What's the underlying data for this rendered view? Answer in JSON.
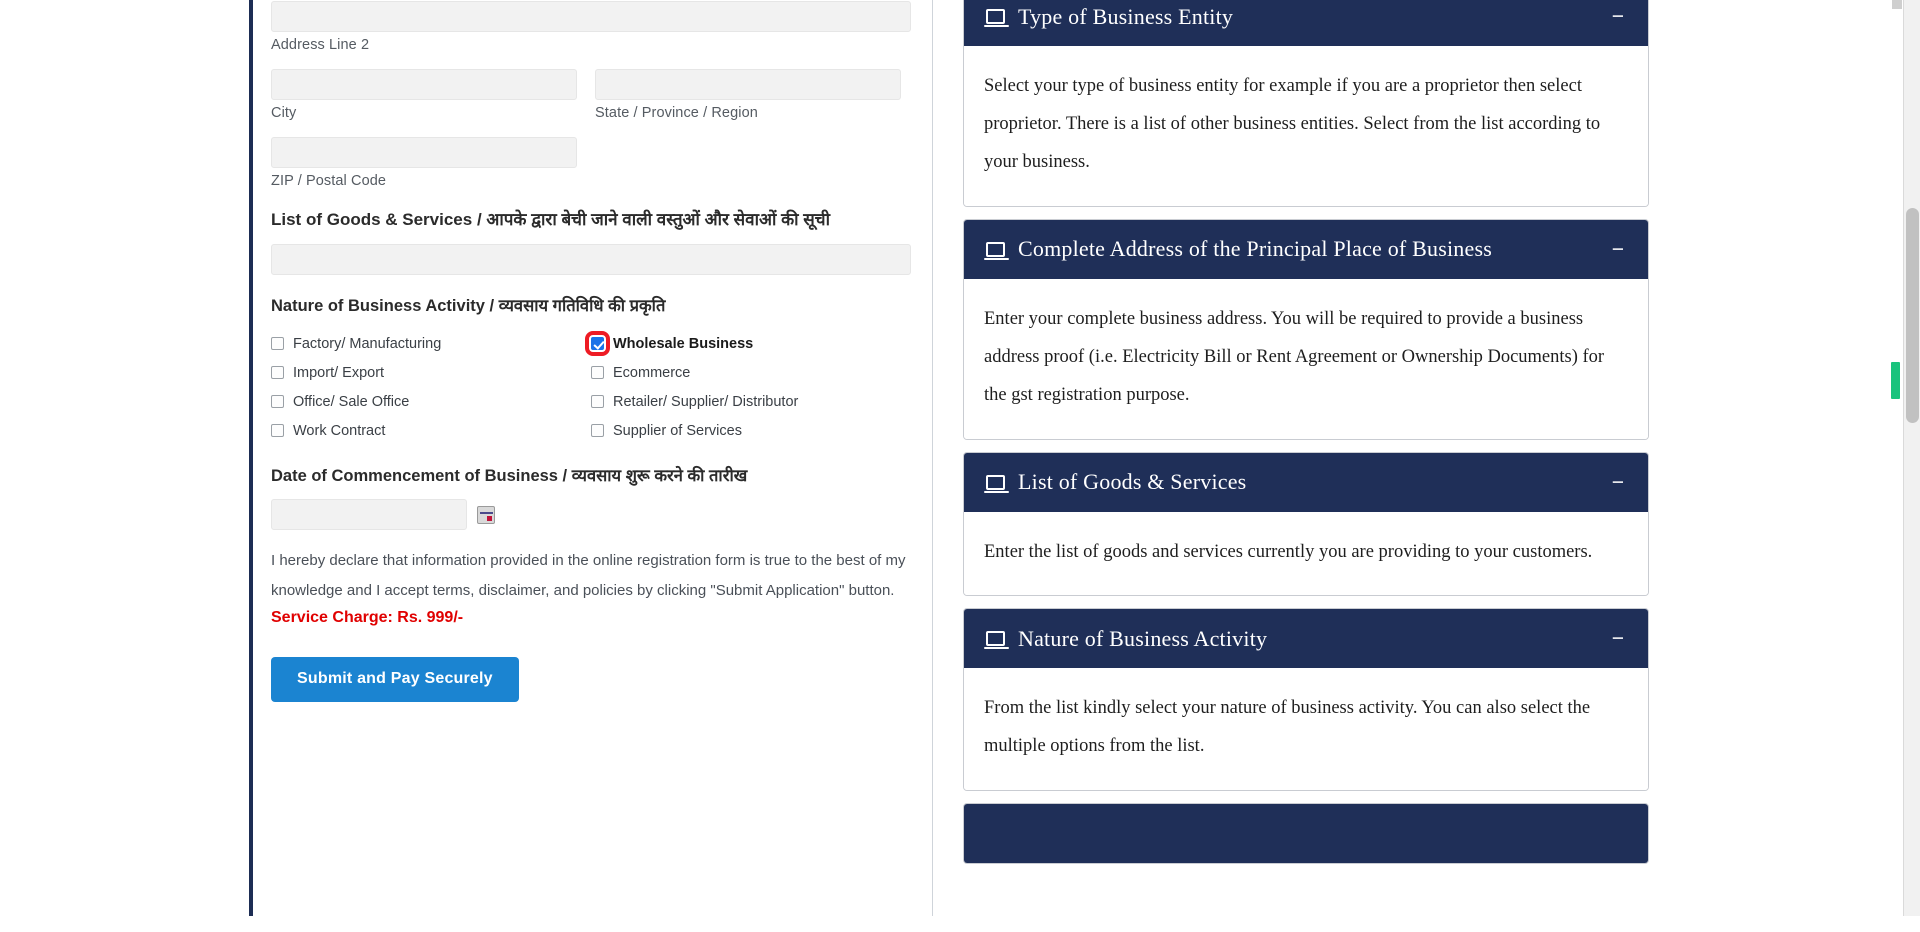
{
  "form": {
    "address_line2_caption": "Address Line 2",
    "city_caption": "City",
    "state_caption": "State / Province / Region",
    "zip_caption": "ZIP / Postal Code",
    "goods_services_title": "List of Goods & Services / आपके द्वारा बेची जाने वाली वस्तुओं और सेवाओं की सूची",
    "nature_title": "Nature of Business Activity / व्यवसाय गतिविधि की प्रकृति",
    "checkboxes": [
      {
        "label": "Factory/ Manufacturing",
        "checked": false,
        "highlighted": false
      },
      {
        "label": "Wholesale Business",
        "checked": true,
        "highlighted": true
      },
      {
        "label": "Import/ Export",
        "checked": false,
        "highlighted": false
      },
      {
        "label": "Ecommerce",
        "checked": false,
        "highlighted": false
      },
      {
        "label": "Office/ Sale Office",
        "checked": false,
        "highlighted": false
      },
      {
        "label": "Retailer/ Supplier/ Distributor",
        "checked": false,
        "highlighted": false
      },
      {
        "label": "Work Contract",
        "checked": false,
        "highlighted": false
      },
      {
        "label": "Supplier of Services",
        "checked": false,
        "highlighted": false
      }
    ],
    "date_title": "Date of Commencement of Business / व्यवसाय शुरू करने की तारीख",
    "date_value": "",
    "declaration": "I hereby declare that information provided in the online registration form is true to the best of my knowledge and I accept terms, disclaimer, and policies by clicking \"Submit Application\" button.",
    "service_charge": "Service Charge: Rs. 999/-",
    "submit_label": "Submit and Pay Securely",
    "accent_color": "#1b84d1",
    "service_charge_color": "#e00000",
    "highlight_color": "#ee1b24"
  },
  "side": {
    "header_color": "#1f2f58",
    "collapse_glyph": "−",
    "panels": [
      {
        "title": "Type of Business Entity",
        "body": "Select your type of business entity for example if you are a proprietor then select proprietor. There is a list of other business entities. Select from the list according to your business."
      },
      {
        "title": "Complete Address of the Principal Place of Business",
        "body": "Enter your complete business address. You will be required to provide a business address proof (i.e. Electricity Bill or Rent Agreement or Ownership Documents) for the gst registration purpose."
      },
      {
        "title": "List of Goods & Services",
        "body": "Enter the list of goods and services currently you are providing to your customers."
      },
      {
        "title": "Nature of Business Activity",
        "body": "From the list kindly select your nature of business activity. You can also select the multiple options from the list."
      }
    ]
  }
}
